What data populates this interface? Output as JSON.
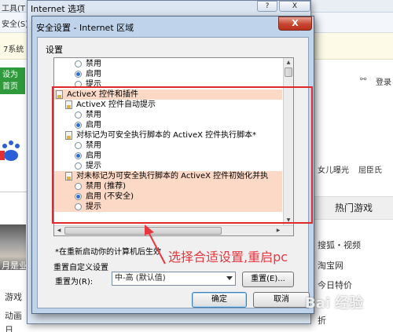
{
  "background": {
    "tab_text_1": "工具(T",
    "tab_text_2": "安全(S)",
    "tab_text_3": "7系统",
    "green_block": "设为\n首页",
    "login": "登录",
    "right_links": [
      "女儿曝光",
      "屈臣氏"
    ],
    "hot_games": "热门游戏",
    "right_list": [
      "搜狐・视频",
      "淘宝网",
      "今日特价",
      "折"
    ],
    "left_list": [
      "月是业",
      "游戏",
      "动画",
      "日"
    ]
  },
  "outer_dialog": {
    "title": "Internet 选项",
    "help": "?",
    "close": "X"
  },
  "dialog": {
    "title": "安全设置 - Internet 区域",
    "close": "X",
    "settings_label": "设置",
    "tree_rows": [
      {
        "kind": "radio",
        "label": "禁用",
        "checked": false,
        "highlight": false
      },
      {
        "kind": "radio",
        "label": "启用",
        "checked": true,
        "highlight": false
      },
      {
        "kind": "radio",
        "label": "提示",
        "checked": false,
        "highlight": false
      },
      {
        "kind": "group",
        "label": "ActiveX 控件和插件",
        "highlight": true
      },
      {
        "kind": "setting",
        "label": "ActiveX 控件自动提示",
        "highlight": false
      },
      {
        "kind": "radio",
        "label": "禁用",
        "checked": false,
        "highlight": false
      },
      {
        "kind": "radio",
        "label": "启用",
        "checked": true,
        "highlight": false
      },
      {
        "kind": "setting",
        "label": "对标记为可安全执行脚本的 ActiveX 控件执行脚本*",
        "highlight": false
      },
      {
        "kind": "radio",
        "label": "禁用",
        "checked": false,
        "highlight": false
      },
      {
        "kind": "radio",
        "label": "启用",
        "checked": true,
        "highlight": false
      },
      {
        "kind": "radio",
        "label": "提示",
        "checked": false,
        "highlight": false
      },
      {
        "kind": "setting",
        "label": "对未标记为可安全执行脚本的 ActiveX 控件初始化并执",
        "highlight": true
      },
      {
        "kind": "radio",
        "label": "禁用 (推荐)",
        "checked": false,
        "highlight": true
      },
      {
        "kind": "radio",
        "label": "启用 (不安全)",
        "checked": true,
        "highlight": true
      },
      {
        "kind": "radio",
        "label": "提示",
        "checked": false,
        "highlight": true
      }
    ],
    "restart_note": "*在重新启动你的计算机后生效",
    "reset_group_label": "重置自定义设置",
    "reset_to_label": "重置为(R):",
    "reset_select_value": "中-高 (默认值)",
    "reset_button": "重置(E)...",
    "ok_button": "确定",
    "cancel_button": "取消"
  },
  "annotation": {
    "text": "选择合适设置,重启pc",
    "color": "#e8383f"
  },
  "watermark": "Bai 经验",
  "colors": {
    "highlight_row": "#fbd9c6",
    "red_frame": "#e02a2a",
    "close_button": "#c7452f",
    "dialog_frame": "#bfd3ea"
  }
}
